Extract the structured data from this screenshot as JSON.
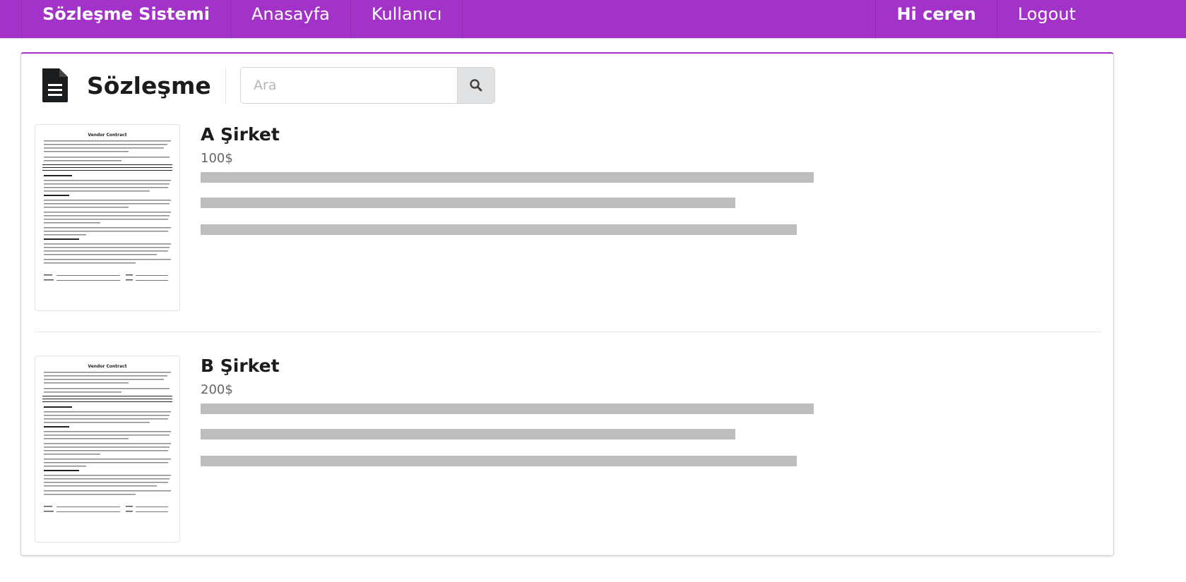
{
  "nav": {
    "brand": "Sözleşme Sistemi",
    "items": [
      {
        "label": "Anasayfa"
      },
      {
        "label": "Kullanıcı"
      }
    ],
    "greeting": "Hi ceren",
    "logout": "Logout"
  },
  "page": {
    "title": "Sözleşme",
    "title_icon": "file-text-icon"
  },
  "search": {
    "placeholder": "Ara",
    "button_icon": "search-icon"
  },
  "contracts": [
    {
      "name": "A Şirket",
      "price": "100$",
      "thumbnail_title": "Vendor Contract"
    },
    {
      "name": "B Şirket",
      "price": "200$",
      "thumbnail_title": "Vendor Contract"
    }
  ],
  "colors": {
    "accent": "#a333c8",
    "placeholder_bar": "#bdbdbd"
  }
}
